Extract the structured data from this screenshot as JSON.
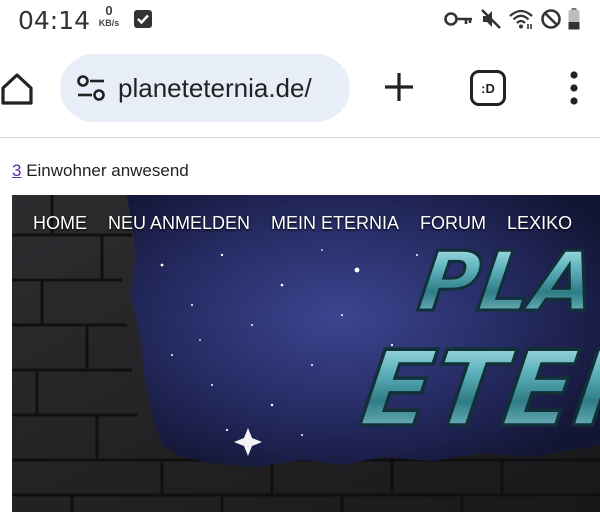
{
  "statusbar": {
    "time": "04:14",
    "net_value": "0",
    "net_unit": "KB/s",
    "icons": [
      "key-icon",
      "mute-icon",
      "wifi-icon",
      "dnd-icon",
      "battery-icon"
    ]
  },
  "browser": {
    "url": "planeteternia.de/",
    "tabs_label": ":D",
    "icons": [
      "home-icon",
      "site-settings-icon",
      "new-tab-icon",
      "tab-switcher-icon",
      "more-menu-icon"
    ],
    "pill_color": "#e8eef8"
  },
  "page": {
    "online_count": "3",
    "online_text": " Einwohner anwesend",
    "link_color": "#5a2ea0",
    "nav_items": [
      "HOME",
      "NEU ANMELDEN",
      "MEIN ETERNIA",
      "FORUM",
      "LEXIKO"
    ],
    "logo_text": "PLANET ETERNIA",
    "logo_visible_lines": [
      "PLA",
      "ETER"
    ]
  }
}
